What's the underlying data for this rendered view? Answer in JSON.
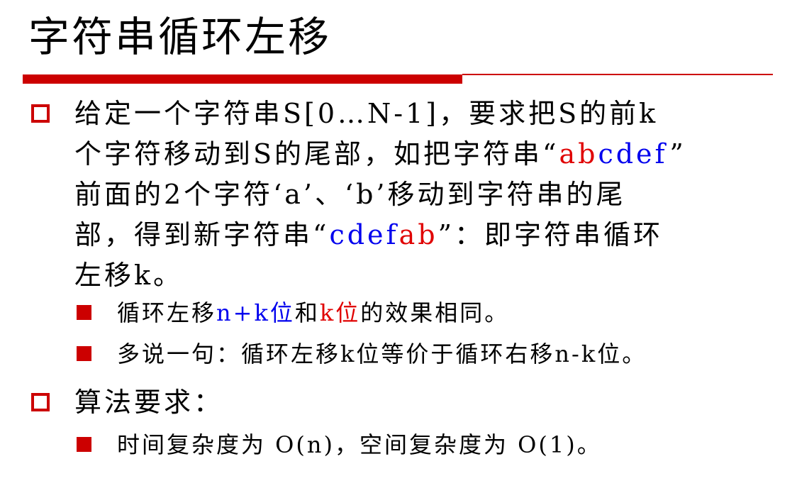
{
  "title": "字符串循环左移",
  "bullet1": {
    "line1": "给定一个字符串S[0…N-1]，要求把S的前k",
    "line2_pre": "个字符移动到S的尾部，如把字符串“",
    "line2_red": "ab",
    "line2_blue": "cdef",
    "line2_post": "”",
    "line3": "前面的2个字符‘a’、‘b’移动到字符串的尾",
    "line4_pre": "部，得到新字符串“",
    "line4_blue": "cdef",
    "line4_red": "ab",
    "line4_post": "”：即字符串循环",
    "line5": "左移k。"
  },
  "sub1": {
    "pre": "循环左移",
    "blue": "n+k位",
    "mid": "和",
    "red": "k位",
    "post": "的效果相同。"
  },
  "sub2": {
    "text": "多说一句：循环左移k位等价于循环右移n-k位。"
  },
  "bullet2": {
    "text": "算法要求："
  },
  "sub3": {
    "text": "时间复杂度为 O(n)，空间复杂度为 O(1)。"
  },
  "colors": {
    "accent": "#cc0000",
    "red_text": "#e00000",
    "blue_text": "#0000ee"
  },
  "icons": {
    "bullet_level1": "hollow-square-icon",
    "bullet_level2": "filled-square-icon"
  }
}
